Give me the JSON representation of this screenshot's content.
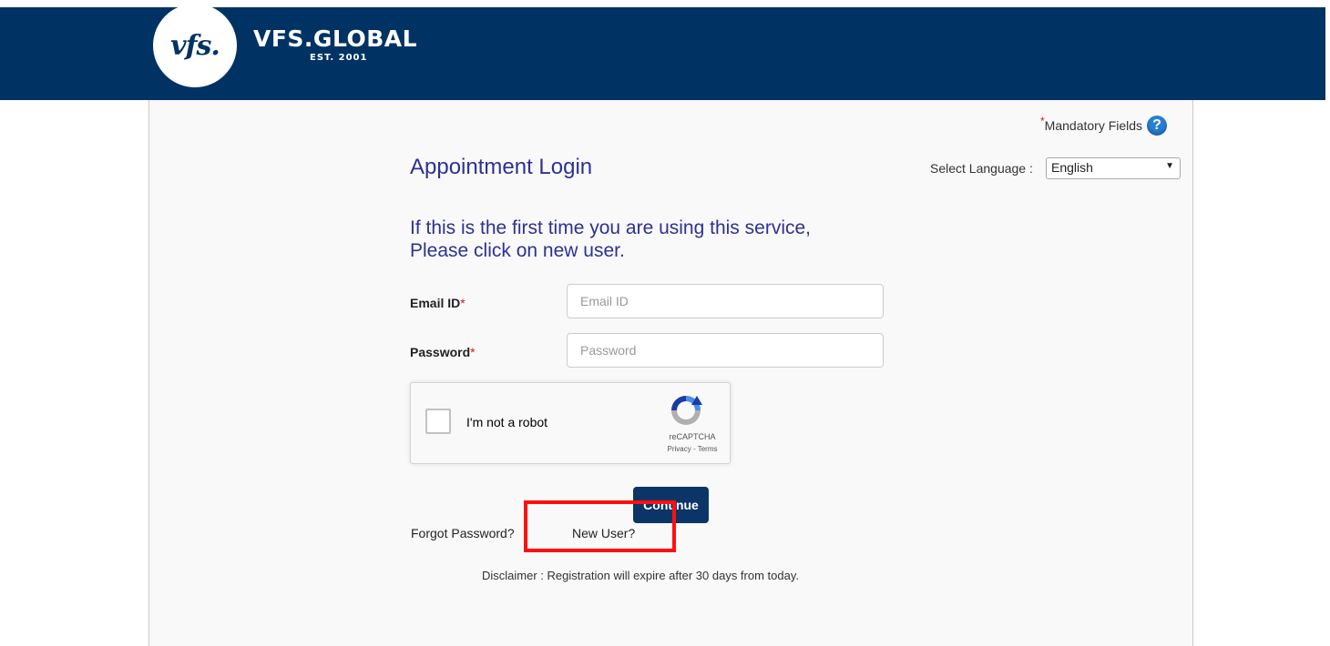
{
  "header": {
    "logo_text": "vfs.",
    "brand_name": "VFS.GLOBAL",
    "brand_est": "EST. 2001"
  },
  "mandatory": {
    "star": "*",
    "label": "Mandatory Fields",
    "help_icon": "?"
  },
  "page": {
    "title": "Appointment Login",
    "intro_line1": "If this is the first time you are using this service,",
    "intro_line2": "Please click on new user."
  },
  "language": {
    "label": "Select Language :",
    "selected": "English"
  },
  "form": {
    "email_label": "Email ID",
    "email_placeholder": "Email ID",
    "email_value": "",
    "password_label": "Password",
    "password_placeholder": "Password",
    "password_value": "",
    "required_mark": "*"
  },
  "captcha": {
    "label": "I'm not a robot",
    "brand": "reCAPTCHA",
    "links": "Privacy - Terms"
  },
  "actions": {
    "continue_label": "Continue",
    "forgot_password": "Forgot Password?",
    "new_user": "New User?"
  },
  "disclaimer": "Disclaimer : Registration will expire after 30 days from today.",
  "colors": {
    "header_bg": "#003363",
    "title_color": "#2e3192",
    "button_bg": "#0b3566",
    "highlight": "#ff1010"
  }
}
